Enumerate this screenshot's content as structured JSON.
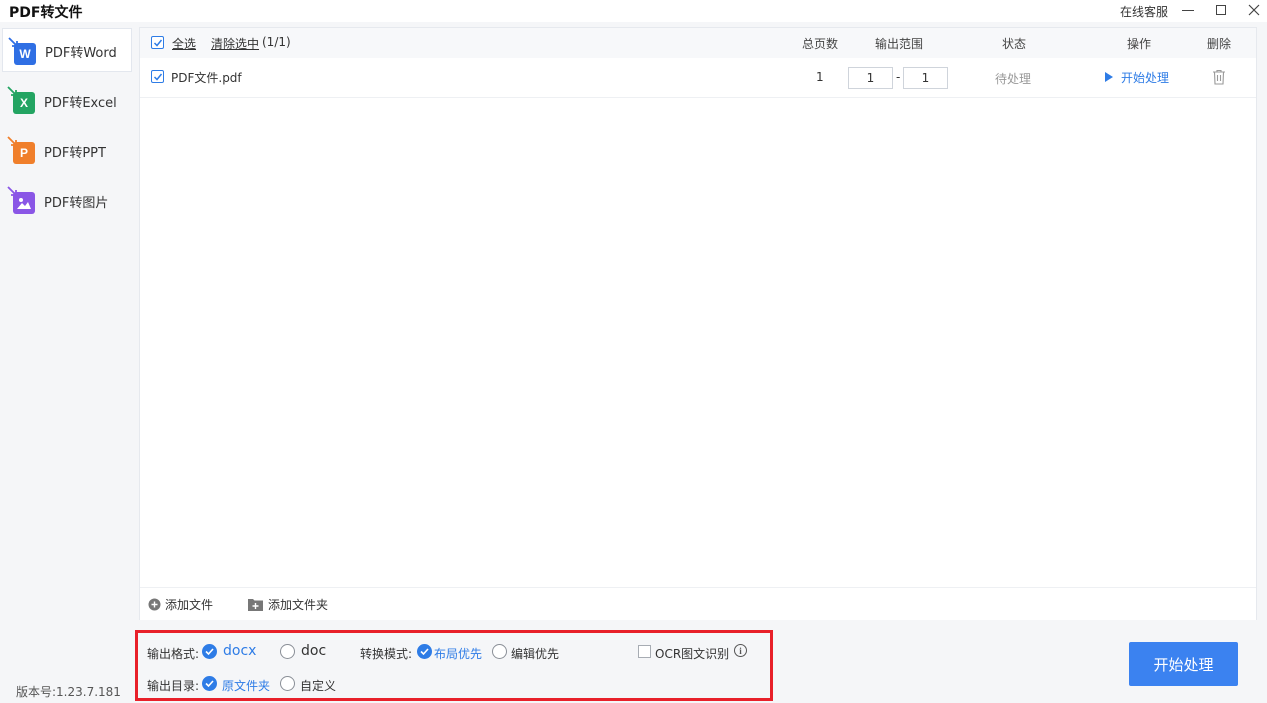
{
  "window": {
    "title": "PDF转文件",
    "service_link": "在线客服"
  },
  "sidebar": {
    "items": [
      {
        "label": "PDF转Word",
        "icon": "word-icon",
        "letter": "W",
        "color": "#2f6fe4"
      },
      {
        "label": "PDF转Excel",
        "icon": "excel-icon",
        "letter": "X",
        "color": "#23a462"
      },
      {
        "label": "PDF转PPT",
        "icon": "ppt-icon",
        "letter": "P",
        "color": "#f07f2b"
      },
      {
        "label": "PDF转图片",
        "icon": "image-icon",
        "letter": "",
        "color": "#8a56e6"
      }
    ],
    "version": "版本号:1.23.7.181"
  },
  "list": {
    "select_all": "全选",
    "clear_selected": "清除选中",
    "selected_count": "(1/1)",
    "columns": {
      "pages": "总页数",
      "range": "输出范围",
      "status": "状态",
      "action": "操作",
      "delete": "删除"
    },
    "rows": [
      {
        "name": "PDF文件.pdf",
        "pages": "1",
        "range_from": "1",
        "range_sep": "-",
        "range_to": "1",
        "status": "待处理",
        "action": "开始处理"
      }
    ],
    "add_file": "添加文件",
    "add_folder": "添加文件夹"
  },
  "options": {
    "format_label": "输出格式:",
    "format_docx": "docx",
    "format_doc": "doc",
    "mode_label": "转换模式:",
    "mode_layout": "布局优先",
    "mode_edit": "编辑优先",
    "ocr_label": "OCR图文识别",
    "dir_label": "输出目录:",
    "dir_source": "原文件夹",
    "dir_custom": "自定义"
  },
  "start_button": "开始处理",
  "colors": {
    "accent": "#2e7ce6",
    "highlight_border": "#e8202a"
  }
}
